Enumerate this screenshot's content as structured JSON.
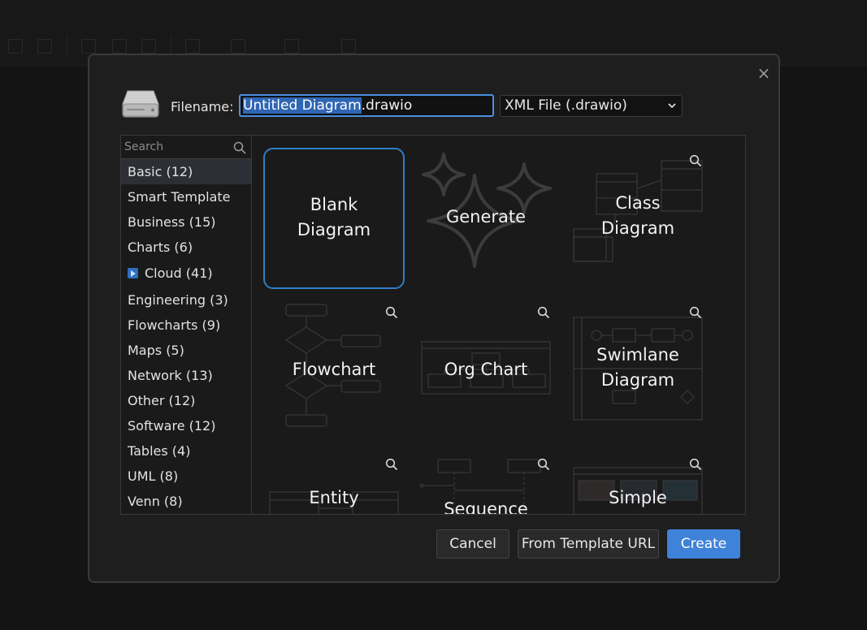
{
  "dialog": {
    "filename_label": "Filename:",
    "filename_selected": "Untitled Diagram",
    "filename_ext": ".drawio",
    "format_value": "XML File (.drawio)",
    "close": "×"
  },
  "search": {
    "placeholder": "Search"
  },
  "categories": [
    "Basic (12)",
    "Smart Template",
    "Business (15)",
    "Charts (6)",
    "Cloud (41)",
    "Engineering (3)",
    "Flowcharts (9)",
    "Maps (5)",
    "Network (13)",
    "Other (12)",
    "Software (12)",
    "Tables (4)",
    "UML (8)",
    "Venn (8)"
  ],
  "templates": {
    "blank": [
      "Blank",
      "Diagram"
    ],
    "generate": "Generate",
    "class": [
      "Class",
      "Diagram"
    ],
    "flowchart": "Flowchart",
    "orgchart": "Org Chart",
    "swimlane": [
      "Swimlane",
      "Diagram"
    ],
    "entity": "Entity",
    "sequence": "Sequence",
    "simple": "Simple"
  },
  "buttons": {
    "cancel": "Cancel",
    "from_url": "From Template URL",
    "create": "Create"
  },
  "colors": {
    "accent": "#3f82d9",
    "selection": "#2f66b3",
    "dialog_bg": "#1e1e1e"
  }
}
